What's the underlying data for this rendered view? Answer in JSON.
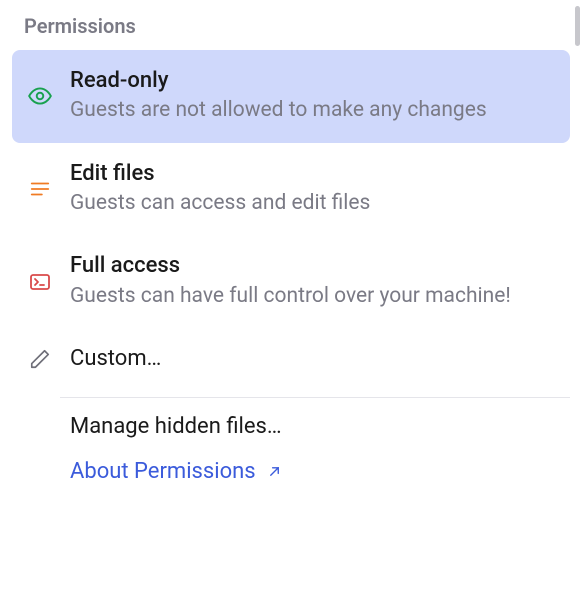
{
  "section_title": "Permissions",
  "options": {
    "read_only": {
      "title": "Read-only",
      "desc": "Guests are not allowed to make any changes",
      "icon": "eye-icon",
      "icon_color": "#19a14f"
    },
    "edit_files": {
      "title": "Edit files",
      "desc": "Guests can access and edit files",
      "icon": "lines-icon",
      "icon_color": "#f07b24"
    },
    "full_access": {
      "title": "Full access",
      "desc": "Guests can have full control over your machine!",
      "icon": "terminal-icon",
      "icon_color": "#d94a4a"
    },
    "custom": {
      "title": "Custom…",
      "icon": "pencil-icon",
      "icon_color": "#6e6e78"
    }
  },
  "footer": {
    "manage_hidden": "Manage hidden files…",
    "about": "About Permissions"
  }
}
